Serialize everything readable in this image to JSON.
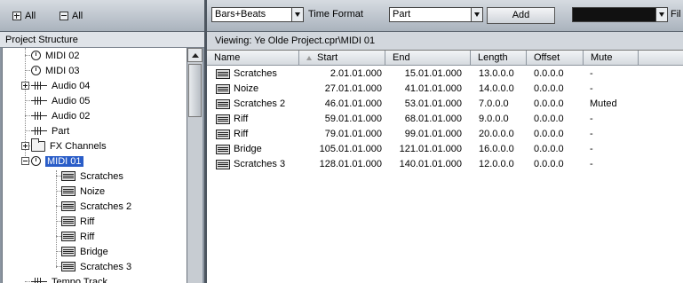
{
  "left_toolbar": {
    "expand_all_label": "All",
    "collapse_all_label": "All"
  },
  "left_header": "Project Structure",
  "tree": [
    {
      "label": "MIDI 02",
      "icon": "clock-icon",
      "selected": false
    },
    {
      "label": "MIDI 03",
      "icon": "clock-icon",
      "selected": false
    },
    {
      "label": "Audio 04",
      "icon": "waveform-icon",
      "selected": false,
      "expander": "plus"
    },
    {
      "label": "Audio 05",
      "icon": "waveform-icon",
      "selected": false
    },
    {
      "label": "Audio 02",
      "icon": "waveform-icon",
      "selected": false
    },
    {
      "label": "Part",
      "icon": "waveform-icon",
      "selected": false
    },
    {
      "label": "FX Channels",
      "icon": "folder-icon",
      "selected": false,
      "expander": "plus"
    },
    {
      "label": "MIDI 01",
      "icon": "clock-icon",
      "selected": true,
      "expander": "minus"
    },
    {
      "label": "Scratches",
      "icon": "midi-part-icon",
      "selected": false
    },
    {
      "label": "Noize",
      "icon": "midi-part-icon",
      "selected": false
    },
    {
      "label": "Scratches 2",
      "icon": "midi-part-icon",
      "selected": false
    },
    {
      "label": "Riff",
      "icon": "midi-part-icon",
      "selected": false
    },
    {
      "label": "Riff",
      "icon": "midi-part-icon",
      "selected": false
    },
    {
      "label": "Bridge",
      "icon": "midi-part-icon",
      "selected": false
    },
    {
      "label": "Scratches 3",
      "icon": "midi-part-icon",
      "selected": false
    },
    {
      "label": "Tempo Track",
      "icon": "tempo-icon",
      "selected": false
    }
  ],
  "right_toolbar": {
    "time_display_value": "Bars+Beats",
    "time_format_label": "Time Format",
    "type_value": "Part",
    "add_label": "Add",
    "filter_label": "Fil"
  },
  "viewing": "Viewing: Ye Olde Project.cpr\\MIDI 01",
  "table": {
    "columns": [
      "Name",
      "Start",
      "End",
      "Length",
      "Offset",
      "Mute"
    ],
    "rows": [
      [
        "Scratches",
        "2.01.01.000",
        "15.01.01.000",
        "13.0.0.0",
        "0.0.0.0",
        "-"
      ],
      [
        "Noize",
        "27.01.01.000",
        "41.01.01.000",
        "14.0.0.0",
        "0.0.0.0",
        "-"
      ],
      [
        "Scratches 2",
        "46.01.01.000",
        "53.01.01.000",
        "7.0.0.0",
        "0.0.0.0",
        "Muted"
      ],
      [
        "Riff",
        "59.01.01.000",
        "68.01.01.000",
        "9.0.0.0",
        "0.0.0.0",
        "-"
      ],
      [
        "Riff",
        "79.01.01.000",
        "99.01.01.000",
        "20.0.0.0",
        "0.0.0.0",
        "-"
      ],
      [
        "Bridge",
        "105.01.01.000",
        "121.01.01.000",
        "16.0.0.0",
        "0.0.0.0",
        "-"
      ],
      [
        "Scratches 3",
        "128.01.01.000",
        "140.01.01.000",
        "12.0.0.0",
        "0.0.0.0",
        "-"
      ]
    ]
  }
}
